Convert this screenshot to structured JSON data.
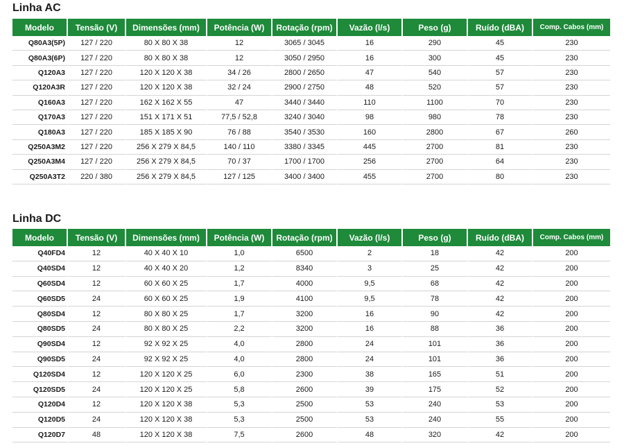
{
  "headers": [
    "Modelo",
    "Tensão (V)",
    "Dimensões (mm)",
    "Potência (W)",
    "Rotação (rpm)",
    "Vazão (l/s)",
    "Peso (g)",
    "Ruído (dBA)",
    "Comp. Cabos (mm)"
  ],
  "colors": {
    "header_background": "#1e8a3a",
    "header_text": "#ffffff",
    "row_separator": "#d4d4d4"
  },
  "sections": [
    {
      "title": "Linha AC",
      "rows": [
        [
          "Q80A3(5P)",
          "127 / 220",
          "80 X 80 X 38",
          "12",
          "3065 / 3045",
          "16",
          "290",
          "45",
          "230"
        ],
        [
          "Q80A3(6P)",
          "127 / 220",
          "80 X 80 X 38",
          "12",
          "3050 / 2950",
          "16",
          "300",
          "45",
          "230"
        ],
        [
          "Q120A3",
          "127 / 220",
          "120 X 120 X 38",
          "34 / 26",
          "2800 / 2650",
          "47",
          "540",
          "57",
          "230"
        ],
        [
          "Q120A3R",
          "127 / 220",
          "120 X 120 X 38",
          "32 / 24",
          "2900 / 2750",
          "48",
          "520",
          "57",
          "230"
        ],
        [
          "Q160A3",
          "127 / 220",
          "162 X 162 X 55",
          "47",
          "3440 / 3440",
          "110",
          "1100",
          "70",
          "230"
        ],
        [
          "Q170A3",
          "127 / 220",
          "151 X 171 X 51",
          "77,5 / 52,8",
          "3240 / 3040",
          "98",
          "980",
          "78",
          "230"
        ],
        [
          "Q180A3",
          "127 / 220",
          "185 X 185 X 90",
          "76 / 88",
          "3540 / 3530",
          "160",
          "2800",
          "67",
          "260"
        ],
        [
          "Q250A3M2",
          "127 / 220",
          "256 X 279 X 84,5",
          "140 / 110",
          "3380 / 3345",
          "445",
          "2700",
          "81",
          "230"
        ],
        [
          "Q250A3M4",
          "127 / 220",
          "256 X 279 X 84,5",
          "70 / 37",
          "1700 / 1700",
          "256",
          "2700",
          "64",
          "230"
        ],
        [
          "Q250A3T2",
          "220 / 380",
          "256 X 279 X 84,5",
          "127 / 125",
          "3400 / 3400",
          "455",
          "2700",
          "80",
          "230"
        ]
      ]
    },
    {
      "title": "Linha DC",
      "rows": [
        [
          "Q40FD4",
          "12",
          "40 X 40 X 10",
          "1,0",
          "6500",
          "2",
          "18",
          "42",
          "200"
        ],
        [
          "Q40SD4",
          "12",
          "40 X 40 X 20",
          "1,2",
          "8340",
          "3",
          "25",
          "42",
          "200"
        ],
        [
          "Q60SD4",
          "12",
          "60 X 60 X 25",
          "1,7",
          "4000",
          "9,5",
          "68",
          "42",
          "200"
        ],
        [
          "Q60SD5",
          "24",
          "60 X 60 X 25",
          "1,9",
          "4100",
          "9,5",
          "78",
          "42",
          "200"
        ],
        [
          "Q80SD4",
          "12",
          "80 X 80 X 25",
          "1,7",
          "3200",
          "16",
          "90",
          "42",
          "200"
        ],
        [
          "Q80SD5",
          "24",
          "80 X 80 X 25",
          "2,2",
          "3200",
          "16",
          "88",
          "36",
          "200"
        ],
        [
          "Q90SD4",
          "12",
          "92 X 92 X 25",
          "4,0",
          "2800",
          "24",
          "101",
          "36",
          "200"
        ],
        [
          "Q90SD5",
          "24",
          "92 X 92 X 25",
          "4,0",
          "2800",
          "24",
          "101",
          "36",
          "200"
        ],
        [
          "Q120SD4",
          "12",
          "120 X 120 X 25",
          "6,0",
          "2300",
          "38",
          "165",
          "51",
          "200"
        ],
        [
          "Q120SD5",
          "24",
          "120 X 120 X 25",
          "5,8",
          "2600",
          "39",
          "175",
          "52",
          "200"
        ],
        [
          "Q120D4",
          "12",
          "120 X 120 X 38",
          "5,3",
          "2500",
          "53",
          "240",
          "53",
          "200"
        ],
        [
          "Q120D5",
          "24",
          "120 X 120 X 38",
          "5,3",
          "2500",
          "53",
          "240",
          "55",
          "200"
        ],
        [
          "Q120D7",
          "48",
          "120 X 120 X 38",
          "7,5",
          "2600",
          "48",
          "320",
          "42",
          "200"
        ]
      ]
    }
  ]
}
